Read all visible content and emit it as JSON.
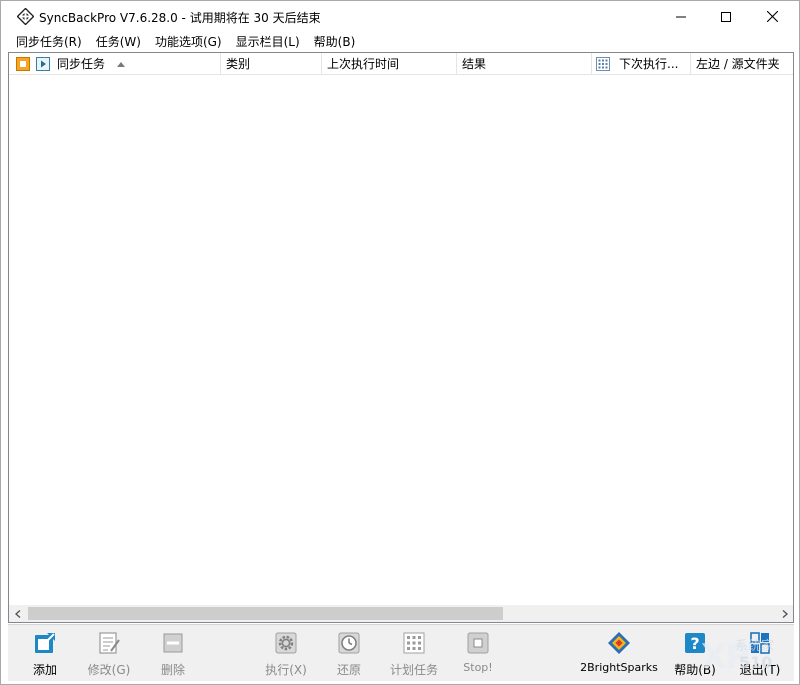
{
  "window": {
    "title": "SyncBackPro V7.6.28.0 - 试用期将在 30 天后结束"
  },
  "menu": {
    "items": [
      {
        "label": "同步任务(R)"
      },
      {
        "label": "任务(W)"
      },
      {
        "label": "功能选项(G)"
      },
      {
        "label": "显示栏目(L)"
      },
      {
        "label": "帮助(B)"
      }
    ]
  },
  "list": {
    "columns": {
      "profile": "同步任务",
      "type": "类别",
      "last_run": "上次执行时间",
      "result": "结果",
      "next_run": "下次执行...",
      "source": "左边 / 源文件夹"
    },
    "rows": []
  },
  "toolbar": {
    "add": "添加",
    "modify": "修改(G)",
    "delete": "删除",
    "run": "执行(X)",
    "restore": "还原",
    "schedule": "计划任务",
    "stop": "Stop!",
    "brand": "2BrightSparks",
    "help": "帮助(B)",
    "exit": "退出(T)"
  },
  "watermark": {
    "logo": "XP",
    "text": "系统家",
    "num": "510"
  },
  "colors": {
    "accent_blue": "#1e73be",
    "disabled_gray": "#8a8a8a",
    "orange": "#f0a030"
  }
}
